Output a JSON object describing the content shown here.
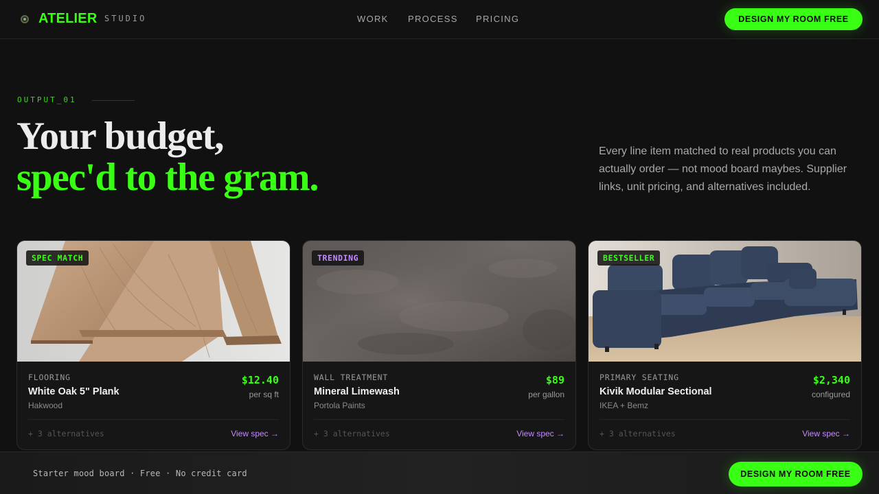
{
  "header": {
    "logo": "ATELIER",
    "logo_sub": "STUDIO",
    "nav": {
      "work": "WORK",
      "process": "PROCESS",
      "pricing": "PRICING"
    },
    "cta": "DESIGN MY ROOM FREE"
  },
  "hero": {
    "eyebrow": "OUTPUT_01",
    "headline_line1": "Your budget,",
    "headline_line2": "spec'd to the gram.",
    "description": "Every line item matched to real products you can actually order — not mood board maybes. Supplier links, unit pricing, and alternatives included."
  },
  "cards": [
    {
      "badge": "SPEC MATCH",
      "category": "FLOORING",
      "name": "White Oak 5\" Plank",
      "brand": "Hakwood",
      "price": "$12.40",
      "unit": "per sq ft",
      "alternatives": "+ 3 alternatives",
      "link": "View spec →"
    },
    {
      "badge": "TRENDING",
      "category": "WALL TREATMENT",
      "name": "Mineral Limewash",
      "brand": "Portola Paints",
      "price": "$89",
      "unit": "per gallon",
      "alternatives": "+ 3 alternatives",
      "link": "View spec →"
    },
    {
      "badge": "BESTSELLER",
      "category": "PRIMARY SEATING",
      "name": "Kivik Modular Sectional",
      "brand": "IKEA + Bemz",
      "price": "$2,340",
      "unit": "configured",
      "alternatives": "+ 3 alternatives",
      "link": "View spec →"
    }
  ],
  "bottom_bar": {
    "text": "Starter mood board · Free · No credit card",
    "cta": "DESIGN MY ROOM FREE"
  },
  "colors": {
    "accent": "#39ff14",
    "link": "#c48bff",
    "background": "#111111"
  }
}
